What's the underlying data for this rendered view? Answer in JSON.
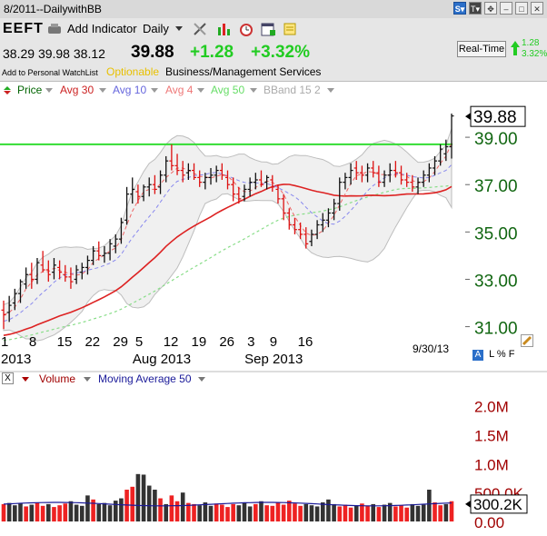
{
  "window": {
    "title": "8/2011--DailywithBB"
  },
  "header": {
    "symbol": "EEFT",
    "add_indicator": "Add Indicator",
    "period": "Daily",
    "open": "38.29",
    "high": "39.98",
    "low": "38.12",
    "last": "39.88",
    "change": "+1.28",
    "change_pct": "+3.32%",
    "watchlist": "Add to Personal WatchList",
    "optionable": "Optionable",
    "sector": "Business/Management Services",
    "realtime": "Real-Time",
    "rt_change": "1.28",
    "rt_pct": "3.32%",
    "colors": {
      "up": "#22cc22",
      "optionable": "#e8c000"
    }
  },
  "indicators": {
    "price": "Price",
    "avg30": "Avg 30",
    "avg10": "Avg 10",
    "avg4": "Avg 4",
    "avg50": "Avg 50",
    "bband": "BBand 15 2"
  },
  "price_axis": {
    "ticks": [
      "39.00",
      "37.00",
      "35.00",
      "33.00",
      "31.00"
    ],
    "current": "39.88"
  },
  "date_axis": {
    "days": [
      "1",
      "8",
      "15",
      "22",
      "29",
      "5",
      "12",
      "19",
      "26",
      "3",
      "9",
      "16"
    ],
    "months": [
      "2013",
      "Aug 2013",
      "Sep 2013"
    ],
    "last_date": "9/30/13"
  },
  "footer_tools": {
    "alert": "A",
    "l": "L",
    "pct": "%",
    "f": "F"
  },
  "volume_panel": {
    "close": "X",
    "volume_label": "Volume",
    "ma_label": "Moving Average 50",
    "ticks": [
      "2.0M",
      "1.5M",
      "1.0M",
      "500.0K",
      "0.00"
    ],
    "current": "300.2K"
  },
  "chart_data": {
    "type": "candlestick",
    "xlabel": "",
    "ylabel": "",
    "ylim": [
      30.6,
      40.5
    ],
    "resistance_line": 38.7,
    "price_bars": [
      {
        "o": 31.7,
        "h": 32.1,
        "l": 30.9,
        "c": 31.5
      },
      {
        "o": 31.6,
        "h": 32.3,
        "l": 31.2,
        "c": 31.9
      },
      {
        "o": 32.0,
        "h": 32.6,
        "l": 31.7,
        "c": 32.4
      },
      {
        "o": 32.4,
        "h": 33.0,
        "l": 32.0,
        "c": 32.9
      },
      {
        "o": 32.8,
        "h": 33.5,
        "l": 32.6,
        "c": 33.2
      },
      {
        "o": 33.2,
        "h": 33.7,
        "l": 32.6,
        "c": 33.0
      },
      {
        "o": 33.0,
        "h": 33.9,
        "l": 32.8,
        "c": 33.7
      },
      {
        "o": 33.6,
        "h": 34.2,
        "l": 33.3,
        "c": 33.4
      },
      {
        "o": 33.4,
        "h": 33.8,
        "l": 32.9,
        "c": 33.2
      },
      {
        "o": 33.3,
        "h": 33.9,
        "l": 33.0,
        "c": 33.6
      },
      {
        "o": 33.5,
        "h": 33.8,
        "l": 33.0,
        "c": 33.3
      },
      {
        "o": 33.2,
        "h": 33.6,
        "l": 32.9,
        "c": 33.1
      },
      {
        "o": 33.1,
        "h": 33.5,
        "l": 32.6,
        "c": 32.9
      },
      {
        "o": 33.0,
        "h": 33.6,
        "l": 32.8,
        "c": 33.4
      },
      {
        "o": 33.3,
        "h": 33.7,
        "l": 33.0,
        "c": 33.5
      },
      {
        "o": 33.5,
        "h": 34.0,
        "l": 33.2,
        "c": 33.8
      },
      {
        "o": 33.8,
        "h": 34.4,
        "l": 33.6,
        "c": 34.2
      },
      {
        "o": 34.2,
        "h": 34.6,
        "l": 33.8,
        "c": 34.0
      },
      {
        "o": 34.0,
        "h": 34.4,
        "l": 33.7,
        "c": 34.1
      },
      {
        "o": 34.1,
        "h": 34.7,
        "l": 33.8,
        "c": 34.5
      },
      {
        "o": 34.4,
        "h": 34.9,
        "l": 34.1,
        "c": 34.7
      },
      {
        "o": 34.7,
        "h": 35.6,
        "l": 34.5,
        "c": 35.4
      },
      {
        "o": 35.5,
        "h": 36.9,
        "l": 35.3,
        "c": 36.6
      },
      {
        "o": 36.6,
        "h": 37.3,
        "l": 36.2,
        "c": 36.8
      },
      {
        "o": 36.7,
        "h": 37.0,
        "l": 36.2,
        "c": 36.5
      },
      {
        "o": 36.5,
        "h": 37.0,
        "l": 36.3,
        "c": 36.9
      },
      {
        "o": 36.9,
        "h": 37.3,
        "l": 36.5,
        "c": 37.0
      },
      {
        "o": 37.0,
        "h": 37.4,
        "l": 36.6,
        "c": 36.8
      },
      {
        "o": 36.9,
        "h": 37.6,
        "l": 36.6,
        "c": 37.4
      },
      {
        "o": 37.4,
        "h": 38.2,
        "l": 37.1,
        "c": 38.0
      },
      {
        "o": 38.0,
        "h": 38.7,
        "l": 37.6,
        "c": 37.8
      },
      {
        "o": 37.8,
        "h": 38.3,
        "l": 37.4,
        "c": 37.6
      },
      {
        "o": 37.6,
        "h": 38.0,
        "l": 37.1,
        "c": 37.4
      },
      {
        "o": 37.5,
        "h": 37.9,
        "l": 37.2,
        "c": 37.6
      },
      {
        "o": 37.6,
        "h": 37.9,
        "l": 37.2,
        "c": 37.3
      },
      {
        "o": 37.3,
        "h": 37.6,
        "l": 36.9,
        "c": 37.1
      },
      {
        "o": 37.1,
        "h": 37.5,
        "l": 36.8,
        "c": 37.3
      },
      {
        "o": 37.3,
        "h": 37.7,
        "l": 37.0,
        "c": 37.4
      },
      {
        "o": 37.4,
        "h": 37.8,
        "l": 37.1,
        "c": 37.6
      },
      {
        "o": 37.6,
        "h": 37.9,
        "l": 37.2,
        "c": 37.4
      },
      {
        "o": 37.3,
        "h": 37.6,
        "l": 36.8,
        "c": 37.0
      },
      {
        "o": 37.0,
        "h": 37.3,
        "l": 36.3,
        "c": 36.6
      },
      {
        "o": 36.6,
        "h": 36.9,
        "l": 36.2,
        "c": 36.4
      },
      {
        "o": 36.5,
        "h": 37.0,
        "l": 36.3,
        "c": 36.8
      },
      {
        "o": 36.8,
        "h": 37.3,
        "l": 36.5,
        "c": 37.1
      },
      {
        "o": 37.1,
        "h": 37.5,
        "l": 36.8,
        "c": 37.2
      },
      {
        "o": 37.2,
        "h": 37.6,
        "l": 36.9,
        "c": 37.0
      },
      {
        "o": 37.1,
        "h": 37.4,
        "l": 36.8,
        "c": 37.3
      },
      {
        "o": 37.2,
        "h": 37.4,
        "l": 36.7,
        "c": 36.9
      },
      {
        "o": 36.8,
        "h": 37.0,
        "l": 36.2,
        "c": 36.4
      },
      {
        "o": 36.4,
        "h": 36.6,
        "l": 35.5,
        "c": 35.8
      },
      {
        "o": 35.8,
        "h": 36.0,
        "l": 35.1,
        "c": 35.3
      },
      {
        "o": 35.3,
        "h": 35.6,
        "l": 34.9,
        "c": 35.1
      },
      {
        "o": 35.1,
        "h": 35.4,
        "l": 34.7,
        "c": 34.9
      },
      {
        "o": 34.9,
        "h": 35.2,
        "l": 34.3,
        "c": 34.5
      },
      {
        "o": 34.6,
        "h": 35.1,
        "l": 34.4,
        "c": 34.9
      },
      {
        "o": 34.9,
        "h": 35.5,
        "l": 34.7,
        "c": 35.3
      },
      {
        "o": 35.3,
        "h": 35.8,
        "l": 35.0,
        "c": 35.5
      },
      {
        "o": 35.5,
        "h": 36.0,
        "l": 35.2,
        "c": 35.8
      },
      {
        "o": 35.8,
        "h": 36.4,
        "l": 35.5,
        "c": 36.2
      },
      {
        "o": 36.2,
        "h": 37.3,
        "l": 35.9,
        "c": 37.1
      },
      {
        "o": 37.1,
        "h": 37.5,
        "l": 36.8,
        "c": 37.3
      },
      {
        "o": 37.3,
        "h": 37.9,
        "l": 37.0,
        "c": 37.6
      },
      {
        "o": 37.7,
        "h": 38.0,
        "l": 37.2,
        "c": 37.5
      },
      {
        "o": 37.5,
        "h": 37.8,
        "l": 37.1,
        "c": 37.4
      },
      {
        "o": 37.4,
        "h": 37.9,
        "l": 37.1,
        "c": 37.7
      },
      {
        "o": 37.7,
        "h": 38.0,
        "l": 37.3,
        "c": 37.5
      },
      {
        "o": 37.5,
        "h": 37.8,
        "l": 36.9,
        "c": 37.1
      },
      {
        "o": 37.1,
        "h": 37.6,
        "l": 36.9,
        "c": 37.4
      },
      {
        "o": 37.4,
        "h": 37.9,
        "l": 37.1,
        "c": 37.6
      },
      {
        "o": 37.6,
        "h": 38.0,
        "l": 37.3,
        "c": 37.5
      },
      {
        "o": 37.5,
        "h": 37.8,
        "l": 37.0,
        "c": 37.2
      },
      {
        "o": 37.2,
        "h": 37.5,
        "l": 36.9,
        "c": 37.1
      },
      {
        "o": 37.1,
        "h": 37.4,
        "l": 36.7,
        "c": 36.9
      },
      {
        "o": 36.9,
        "h": 37.3,
        "l": 36.6,
        "c": 37.1
      },
      {
        "o": 37.1,
        "h": 37.6,
        "l": 36.9,
        "c": 37.4
      },
      {
        "o": 37.4,
        "h": 37.9,
        "l": 37.1,
        "c": 37.7
      },
      {
        "o": 37.7,
        "h": 38.2,
        "l": 37.4,
        "c": 38.0
      },
      {
        "o": 38.0,
        "h": 38.7,
        "l": 37.8,
        "c": 38.5
      },
      {
        "o": 38.3,
        "h": 38.9,
        "l": 38.0,
        "c": 38.6
      },
      {
        "o": 38.6,
        "h": 40.0,
        "l": 38.1,
        "c": 39.9
      }
    ],
    "volume": {
      "ylim": [
        0,
        2.2
      ],
      "unit": "M",
      "values": [
        0.3,
        0.32,
        0.28,
        0.31,
        0.26,
        0.29,
        0.33,
        0.27,
        0.3,
        0.25,
        0.28,
        0.31,
        0.35,
        0.29,
        0.27,
        0.45,
        0.38,
        0.3,
        0.32,
        0.28,
        0.36,
        0.4,
        0.55,
        0.6,
        0.82,
        0.81,
        0.62,
        0.55,
        0.4,
        0.3,
        0.45,
        0.35,
        0.5,
        0.32,
        0.3,
        0.28,
        0.33,
        0.27,
        0.31,
        0.29,
        0.25,
        0.3,
        0.28,
        0.32,
        0.26,
        0.3,
        0.35,
        0.28,
        0.27,
        0.33,
        0.29,
        0.36,
        0.31,
        0.27,
        0.3,
        0.28,
        0.26,
        0.33,
        0.38,
        0.3,
        0.26,
        0.29,
        0.24,
        0.28,
        0.31,
        0.27,
        0.3,
        0.25,
        0.29,
        0.32,
        0.26,
        0.28,
        0.24,
        0.3,
        0.27,
        0.29,
        0.55,
        0.33,
        0.28,
        0.3,
        0.35
      ],
      "up_down": [
        "d",
        "u",
        "u",
        "u",
        "d",
        "u",
        "d",
        "d",
        "u",
        "d",
        "d",
        "d",
        "u",
        "u",
        "u",
        "u",
        "d",
        "u",
        "u",
        "u",
        "u",
        "u",
        "d",
        "d",
        "u",
        "u",
        "u",
        "u",
        "d",
        "u",
        "d",
        "d",
        "u",
        "d",
        "d",
        "u",
        "u",
        "u",
        "d",
        "d",
        "d",
        "d",
        "u",
        "u",
        "u",
        "d",
        "u",
        "d",
        "d",
        "d",
        "d",
        "d",
        "d",
        "d",
        "u",
        "u",
        "u",
        "u",
        "u",
        "u",
        "d",
        "d",
        "d",
        "u",
        "d",
        "d",
        "u",
        "d",
        "u",
        "u",
        "d",
        "d",
        "d",
        "u",
        "u",
        "u",
        "u",
        "d",
        "d",
        "u",
        "d"
      ],
      "ma50": 0.3,
      "current": 0.3002
    }
  }
}
